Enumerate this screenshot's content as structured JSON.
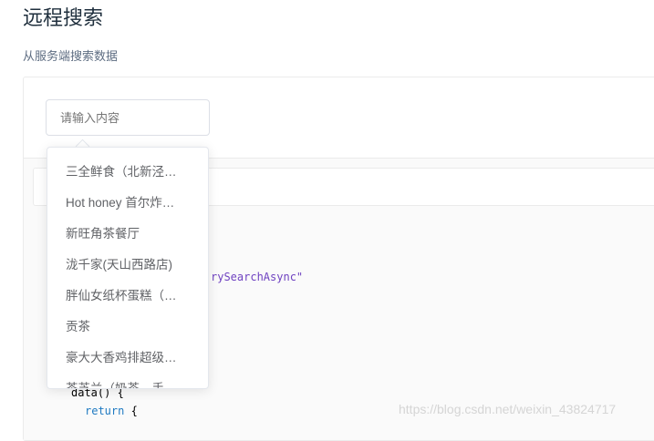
{
  "page": {
    "title": "远程搜索",
    "subtitle": "从服务端搜索数据"
  },
  "input": {
    "placeholder": "请输入内容"
  },
  "suggestions": [
    "三全鲜食（北新泾…",
    "Hot honey 首尔炸…",
    "新旺角茶餐厅",
    "泷千家(天山西路店)",
    "胖仙女纸杯蛋糕（…",
    "贡茶",
    "豪大大香鸡排超级…",
    "茶芝兰（奶茶，手…"
  ],
  "code": {
    "fetch": "rySearchAsync\"",
    "data": "data() {",
    "ret": "return",
    "brace": " {"
  },
  "watermark": "https://blog.csdn.net/weixin_43824717"
}
